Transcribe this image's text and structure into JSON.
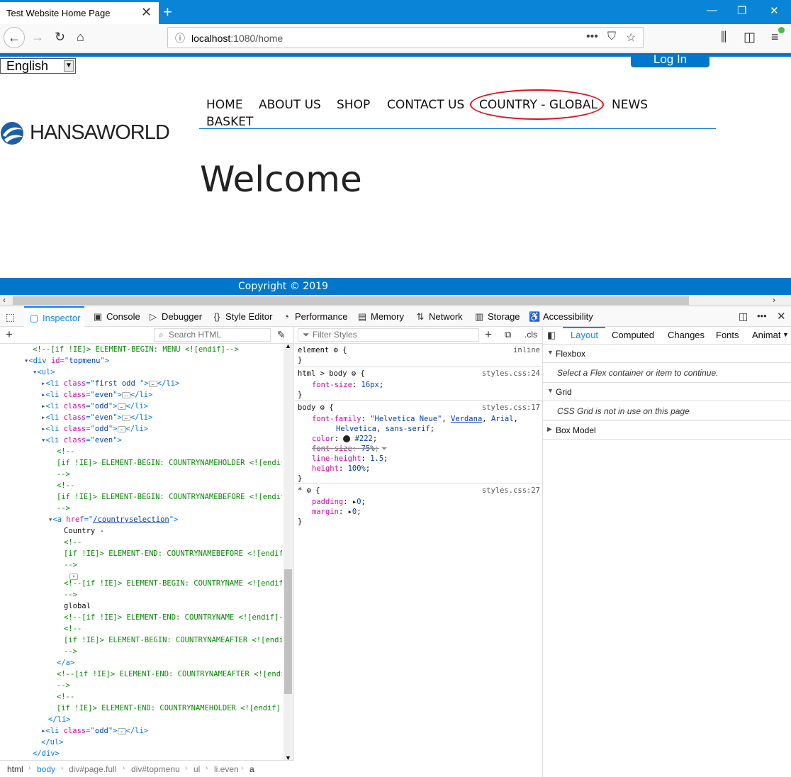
{
  "browser": {
    "tab_title": "Test Website Home Page",
    "url_host": "localhost",
    "url_rest": ":1080/home"
  },
  "page": {
    "language": "English",
    "login_label": "Log In",
    "logo_text": "HANSAWORLD",
    "menu": [
      "HOME",
      "ABOUT US",
      "SHOP",
      "CONTACT US",
      "COUNTRY - GLOBAL",
      "NEWS",
      "BASKET"
    ],
    "heading": "Welcome",
    "footer": "Copyright © 2019"
  },
  "devtools": {
    "tabs": [
      "Inspector",
      "Console",
      "Debugger",
      "Style Editor",
      "Performance",
      "Memory",
      "Network",
      "Storage",
      "Accessibility"
    ],
    "search_html_placeholder": "Search HTML",
    "filter_styles_placeholder": "Filter Styles",
    "cls_label": ".cls",
    "breadcrumbs": [
      "html",
      "body",
      "div#page.full",
      "div#topmenu",
      "ul",
      "li.even",
      "a"
    ],
    "layout_tabs": [
      "Layout",
      "Computed",
      "Changes",
      "Fonts",
      "Animat"
    ],
    "flexbox_label": "Flexbox",
    "flexbox_note": "Select a Flex container or item to continue.",
    "grid_label": "Grid",
    "grid_note": "CSS Grid is not in use on this page",
    "boxmodel_label": "Box Model"
  }
}
